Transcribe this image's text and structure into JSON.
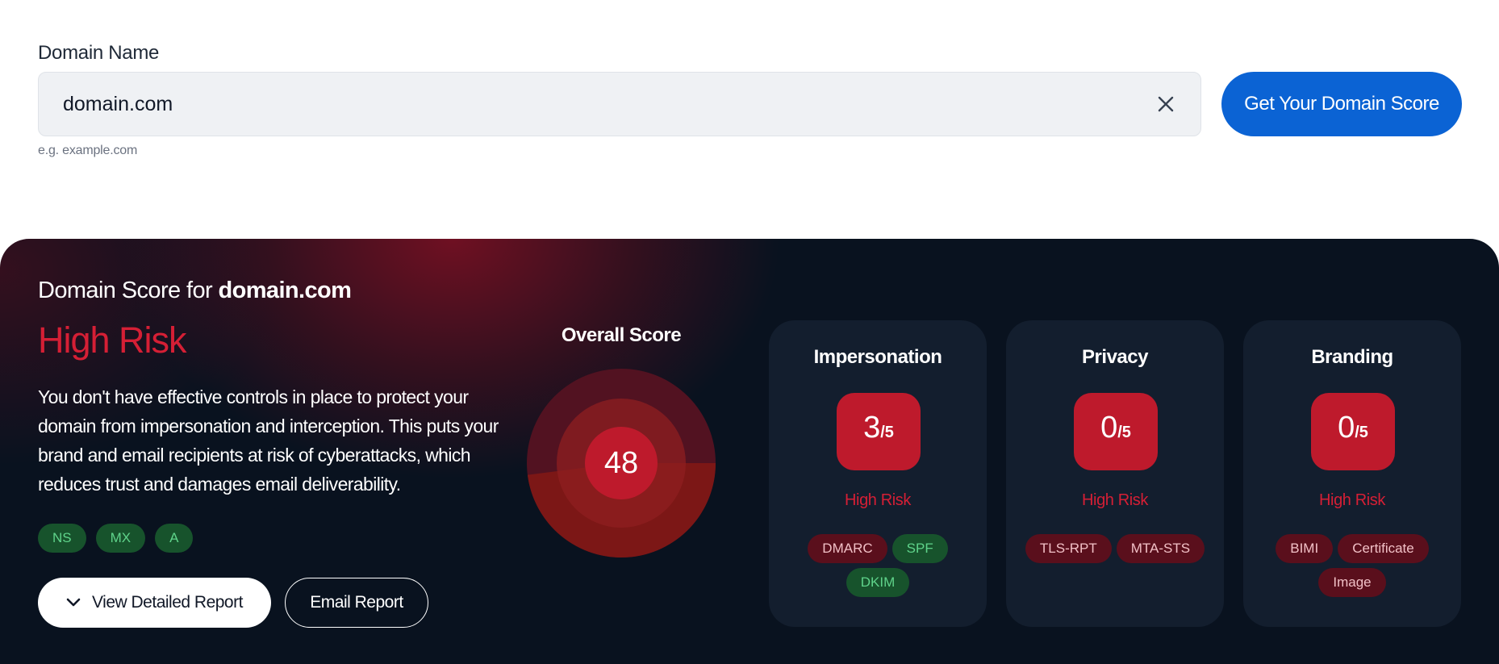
{
  "form": {
    "label": "Domain Name",
    "value": "domain.com",
    "hint": "e.g. example.com",
    "submit_label": "Get Your Domain Score",
    "clear_icon": "close-icon"
  },
  "result": {
    "prefix": "Domain Score for ",
    "domain": "domain.com",
    "risk_level": "High Risk",
    "description": "You don't have effective controls in place to protect your domain from impersonation and interception. This puts your brand and email recipients at risk of cyberattacks, which reduces trust and damages email deliverability.",
    "records": [
      "NS",
      "MX",
      "A"
    ],
    "detailed_report_label": "View Detailed Report",
    "email_report_label": "Email Report",
    "expand_icon": "chevron-down-icon"
  },
  "overall": {
    "title": "Overall Score",
    "score": "48",
    "score_value": 48,
    "score_max": 100
  },
  "categories": [
    {
      "name": "Impersonation",
      "score": "3",
      "max": "/5",
      "risk": "High Risk",
      "tags": [
        {
          "label": "DMARC",
          "status": "fail"
        },
        {
          "label": "SPF",
          "status": "pass"
        },
        {
          "label": "DKIM",
          "status": "pass"
        }
      ]
    },
    {
      "name": "Privacy",
      "score": "0",
      "max": "/5",
      "risk": "High Risk",
      "tags": [
        {
          "label": "TLS-RPT",
          "status": "fail"
        },
        {
          "label": "MTA-STS",
          "status": "fail"
        }
      ]
    },
    {
      "name": "Branding",
      "score": "0",
      "max": "/5",
      "risk": "High Risk",
      "tags": [
        {
          "label": "BIMI",
          "status": "fail"
        },
        {
          "label": "Certificate",
          "status": "fail"
        },
        {
          "label": "Image",
          "status": "fail"
        }
      ]
    }
  ],
  "colors": {
    "accent": "#0b63d4",
    "risk_red": "#d51f35",
    "score_red": "#be1a2c",
    "pass_green": "#5fd38a",
    "panel_bg": "#09121f",
    "card_bg": "#131e2e"
  }
}
